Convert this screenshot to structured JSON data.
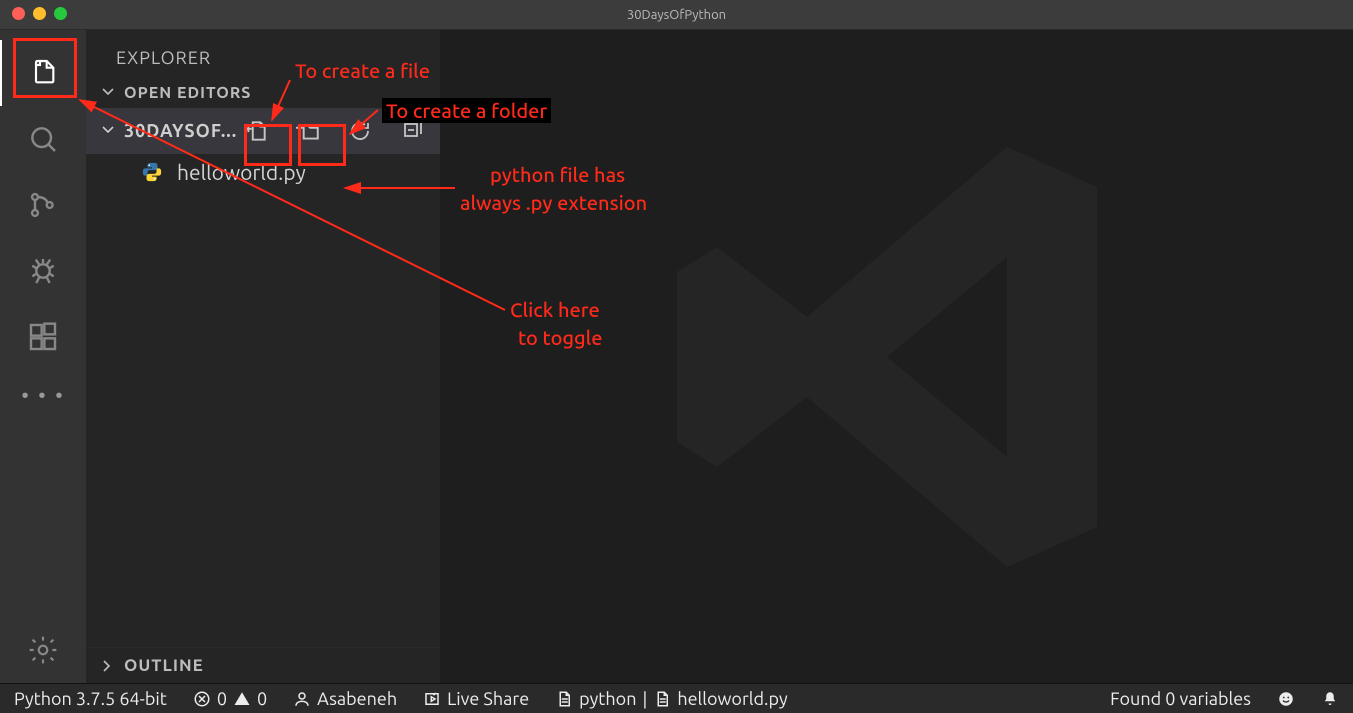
{
  "window": {
    "title": "30DaysOfPython"
  },
  "sidebar": {
    "title": "EXPLORER",
    "open_editors_label": "OPEN EDITORS",
    "workspace_name": "30DAYSOF...",
    "outline_label": "OUTLINE",
    "files": [
      {
        "name": "helloworld.py",
        "icon": "python-file-icon"
      }
    ]
  },
  "activity": {
    "items": [
      "explorer",
      "search",
      "source-control",
      "debug",
      "extensions"
    ]
  },
  "status": {
    "python": "Python 3.7.5 64-bit",
    "errors": "0",
    "warnings": "0",
    "user": "Asabeneh",
    "live_share": "Live Share",
    "lang": "python",
    "file": "helloworld.py",
    "variables": "Found 0 variables"
  },
  "annotations": {
    "create_file": "To create a file",
    "create_folder": "To create a folder",
    "py_ext_line1": "python file has",
    "py_ext_line2": "always .py extension",
    "toggle_line1": "Click here",
    "toggle_line2": "to toggle"
  }
}
